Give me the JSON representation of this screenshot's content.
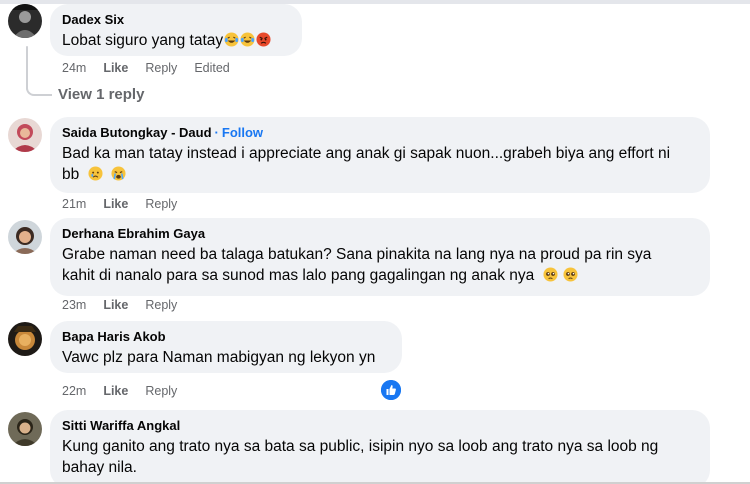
{
  "comments": [
    {
      "author": "Dadex Six",
      "text": "Lobat siguro yang tatay",
      "emojis": [
        "laughing-tears-emoji",
        "laughing-tears-emoji",
        "angry-emoji"
      ],
      "time": "24m",
      "like_label": "Like",
      "reply_label": "Reply",
      "edited_label": "Edited",
      "view_replies": "View 1 reply"
    },
    {
      "author": "Saida Butongkay - Daud",
      "separator": "·",
      "follow_label": "Follow",
      "text_line1": "Bad ka man tatay instead i appreciate ang anak gi sapak nuon...grabeh biya ang effort ni",
      "text_line2": "bb",
      "emojis": [
        "sad-tear-emoji",
        "crying-emoji"
      ],
      "time": "21m",
      "like_label": "Like",
      "reply_label": "Reply"
    },
    {
      "author": "Derhana Ebrahim Gaya",
      "text_line1": "Grabe naman need ba talaga batukan? Sana pinakita na lang nya na proud pa rin sya",
      "text_line2": "kahit di nanalo para sa sunod mas lalo pang gagalingan ng anak nya",
      "emojis": [
        "pleading-emoji",
        "pleading-emoji"
      ],
      "time": "23m",
      "like_label": "Like",
      "reply_label": "Reply"
    },
    {
      "author": "Bapa Haris Akob",
      "text": "Vawc plz para Naman mabigyan ng lekyon yn",
      "time": "22m",
      "like_label": "Like",
      "reply_label": "Reply",
      "reaction": "like-reaction-icon"
    },
    {
      "author": "Sitti Wariffa Angkal",
      "text_line1": "Kung ganito ang trato nya sa bata sa public, isipin nyo sa loob ang trato nya sa loob ng",
      "text_line2": "bahay nila."
    }
  ],
  "colors": {
    "bubble": "#f0f2f5",
    "link_blue": "#1877f2",
    "meta_gray": "#65676b",
    "text": "#050505"
  }
}
